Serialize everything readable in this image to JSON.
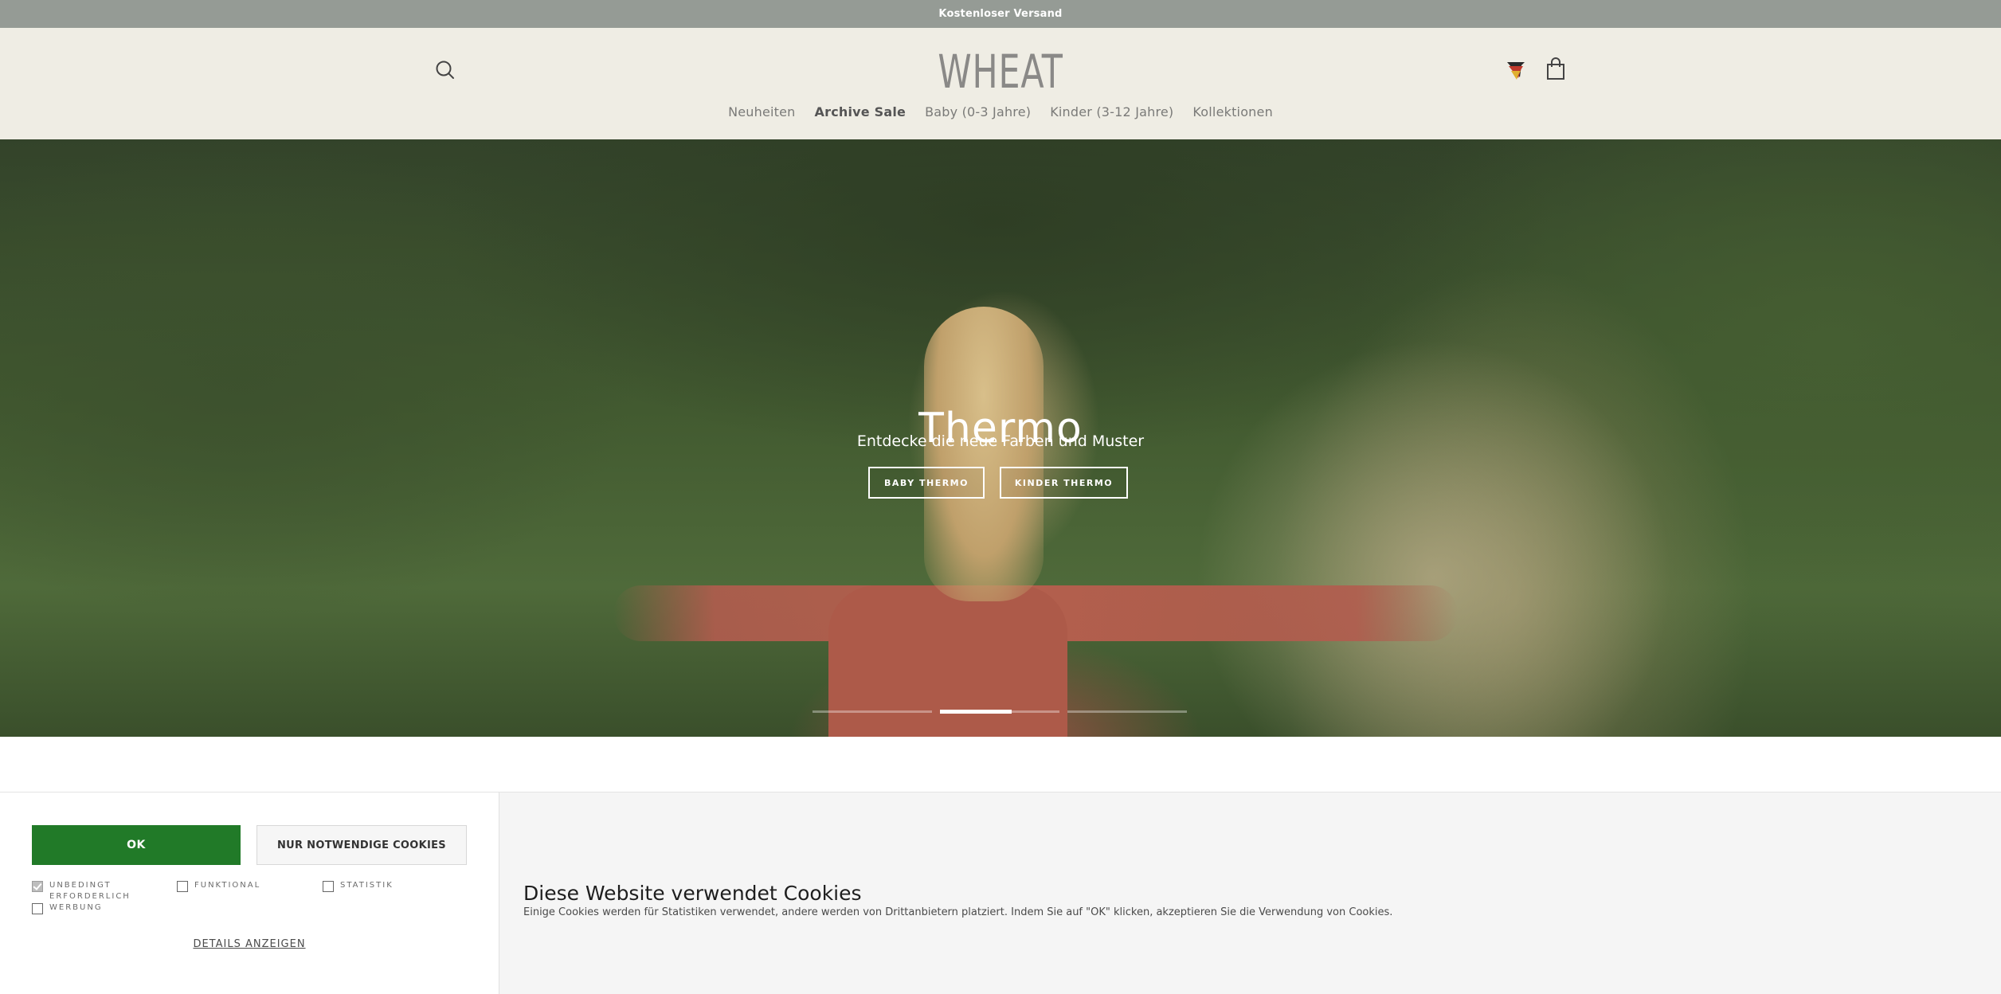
{
  "announcement": {
    "text": "Kostenloser Versand"
  },
  "header": {
    "logo": "WHEAT",
    "icons": {
      "search": "search-icon",
      "flag": "flag-icon",
      "cart": "shopping-bag-icon"
    },
    "nav": [
      {
        "label": "Neuheiten",
        "bold": false
      },
      {
        "label": "Archive Sale",
        "bold": true
      },
      {
        "label": "Baby (0-3 Jahre)",
        "bold": false
      },
      {
        "label": "Kinder (3-12 Jahre)",
        "bold": false
      },
      {
        "label": "Kollektionen",
        "bold": false
      }
    ]
  },
  "hero": {
    "title": "Thermo",
    "subtitle": "Entdecke die neue Farben und Muster",
    "buttons": [
      "BABY THERMO",
      "KINDER THERMO"
    ],
    "slides": {
      "count": 3,
      "active": 2,
      "active_progress": 0.6
    }
  },
  "cookie": {
    "ok_label": "OK",
    "necessary_label": "NUR NOTWENDIGE COOKIES",
    "options": [
      {
        "label": "UNBEDINGT ERFORDERLICH",
        "checked": true
      },
      {
        "label": "FUNKTIONAL",
        "checked": false
      },
      {
        "label": "STATISTIK",
        "checked": false
      },
      {
        "label": "WERBUNG",
        "checked": false
      }
    ],
    "details_label": "DETAILS ANZEIGEN",
    "title": "Diese Website verwendet Cookies",
    "text": "Einige Cookies werden für Statistiken verwendet, andere werden von Drittanbietern platziert. Indem Sie auf \"OK\" klicken, akzeptieren Sie die Verwendung von Cookies."
  },
  "colors": {
    "announcement_bg": "#959b95",
    "header_bg": "#efede4",
    "ok_button": "#217a28"
  }
}
